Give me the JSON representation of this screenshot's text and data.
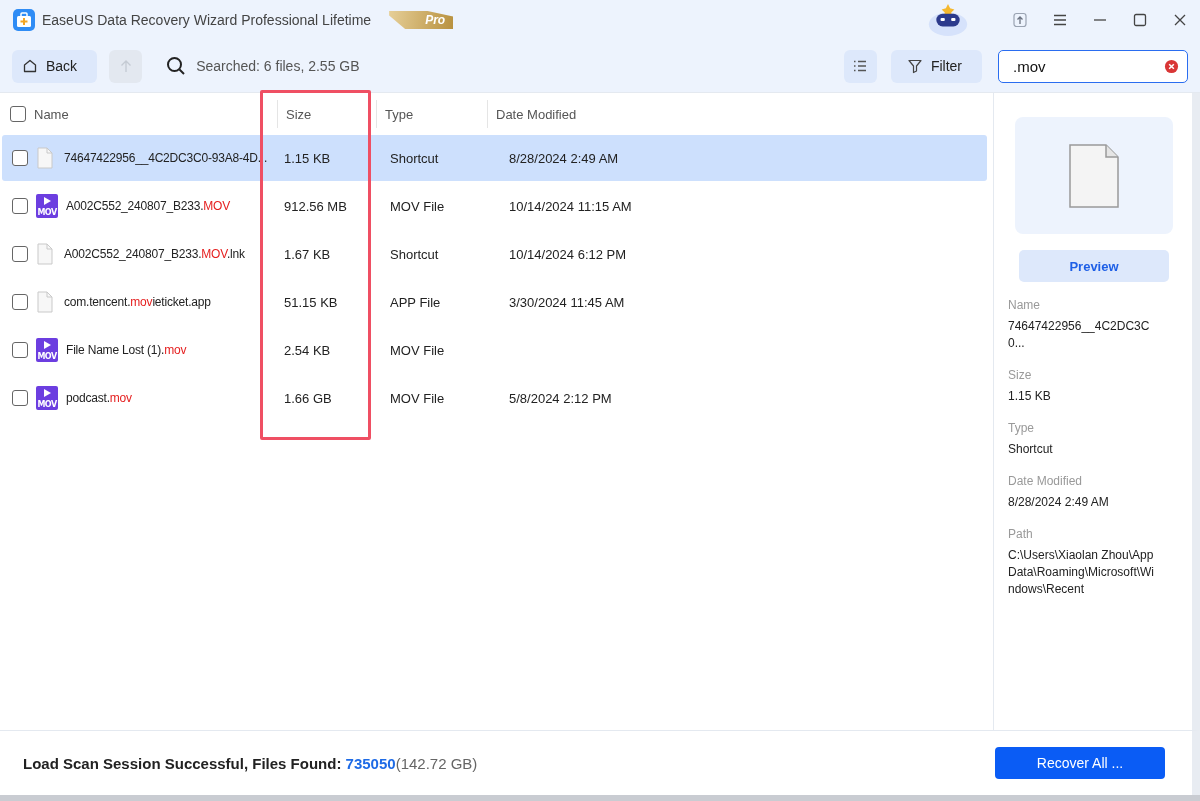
{
  "window": {
    "title": "EaseUS Data Recovery Wizard Professional Lifetime",
    "badge": "Pro"
  },
  "toolbar": {
    "back": "Back",
    "search_status": "Searched: 6 files, 2.55 GB",
    "filter": "Filter",
    "search": {
      "value": ".mov"
    }
  },
  "table": {
    "select_all_checked": false,
    "columns": [
      "Name",
      "Size",
      "Type",
      "Date Modified"
    ],
    "rows": [
      {
        "kind": "file",
        "selected": true,
        "checked": false,
        "name": [
          {
            "text": "74647422956__4C2DC3C0-93A8-4D...",
            "match": false
          }
        ],
        "size": "1.15 KB",
        "type": "Shortcut",
        "date": "8/28/2024 2:49 AM"
      },
      {
        "kind": "video",
        "icon_label": "MOV",
        "selected": false,
        "checked": false,
        "name": [
          {
            "text": "A002C552_240807_B233.",
            "match": false
          },
          {
            "text": "MOV",
            "match": true
          }
        ],
        "size": "912.56 MB",
        "type": "MOV File",
        "date": "10/14/2024 11:15 AM"
      },
      {
        "kind": "file",
        "selected": false,
        "checked": false,
        "name": [
          {
            "text": "A002C552_240807_B233.",
            "match": false
          },
          {
            "text": "MOV",
            "match": true
          },
          {
            "text": ".lnk",
            "match": false
          }
        ],
        "size": "1.67 KB",
        "type": "Shortcut",
        "date": "10/14/2024 6:12 PM"
      },
      {
        "kind": "file",
        "selected": false,
        "checked": false,
        "name": [
          {
            "text": "com.tencent.",
            "match": false
          },
          {
            "text": "mov",
            "match": true
          },
          {
            "text": "ieticket.app",
            "match": false
          }
        ],
        "size": "51.15 KB",
        "type": "APP File",
        "date": "3/30/2024 11:45 AM"
      },
      {
        "kind": "video",
        "icon_label": "MOV",
        "selected": false,
        "checked": false,
        "name": [
          {
            "text": "File Name Lost (1).",
            "match": false
          },
          {
            "text": "mov",
            "match": true
          }
        ],
        "size": "2.54 KB",
        "type": "MOV File",
        "date": ""
      },
      {
        "kind": "video",
        "icon_label": "MOV",
        "selected": false,
        "checked": false,
        "name": [
          {
            "text": "podcast.",
            "match": false
          },
          {
            "text": "mov",
            "match": true
          }
        ],
        "size": "1.66 GB",
        "type": "MOV File",
        "date": "5/8/2024 2:12 PM"
      }
    ]
  },
  "details": {
    "preview": "Preview",
    "fields": [
      {
        "label": "Name",
        "value": "74647422956__4C2DC3C0..."
      },
      {
        "label": "Size",
        "value": "1.15 KB"
      },
      {
        "label": "Type",
        "value": "Shortcut"
      },
      {
        "label": "Date Modified",
        "value": "8/28/2024 2:49 AM"
      },
      {
        "label": "Path",
        "value": "C:\\Users\\Xiaolan Zhou\\AppData\\Roaming\\Microsoft\\Windows\\Recent"
      }
    ]
  },
  "status_bar": {
    "message": "Load Scan Session Successful, Files Found: ",
    "count": "735050",
    "size": "(142.72 GB)",
    "recover": "Recover All ..."
  }
}
